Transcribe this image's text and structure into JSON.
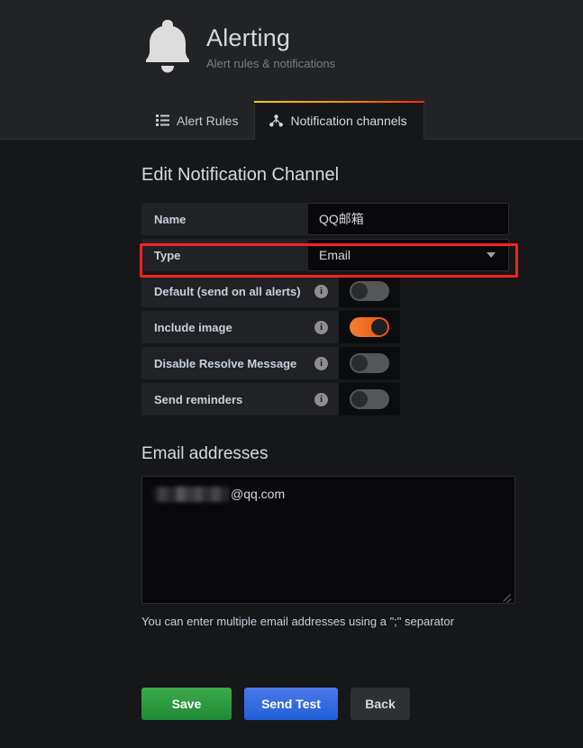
{
  "header": {
    "icon": "bell-icon",
    "title": "Alerting",
    "subtitle": "Alert rules & notifications"
  },
  "tabs": [
    {
      "label": "Alert Rules",
      "icon": "list-ul-icon",
      "active": false
    },
    {
      "label": "Notification channels",
      "icon": "share-alt-icon",
      "active": true
    }
  ],
  "main": {
    "section_title": "Edit Notification Channel",
    "fields": [
      {
        "label": "Name",
        "value": "QQ邮箱",
        "type": "text"
      },
      {
        "label": "Type",
        "value": "Email",
        "type": "select"
      }
    ],
    "switches": [
      {
        "label": "Default (send on all alerts)",
        "info": "i",
        "on": false
      },
      {
        "label": "Include image",
        "info": "i",
        "on": true
      },
      {
        "label": "Disable Resolve Message",
        "info": "i",
        "on": false
      },
      {
        "label": "Send reminders",
        "info": "i",
        "on": false
      }
    ],
    "email_section": {
      "heading": "Email addresses",
      "value_suffix": "@qq.com",
      "help": "You can enter multiple email addresses using a \";\" separator"
    },
    "buttons": [
      {
        "label": "Save",
        "style": "success"
      },
      {
        "label": "Send Test",
        "style": "primary"
      },
      {
        "label": "Back",
        "style": "inverse"
      }
    ]
  },
  "colors": {
    "page_bg": "#161719",
    "header_bg": "#222326",
    "panel_bg": "#202226",
    "input_bg": "#09090b",
    "accent_start": "#f2cc0c",
    "accent_end": "#ff2b00",
    "toggle_on": "#eb7b18",
    "toggle_off": "#555659",
    "save_green": "#1f8a36",
    "test_blue": "#1f60d8",
    "annotation_red": "#ff2020"
  }
}
